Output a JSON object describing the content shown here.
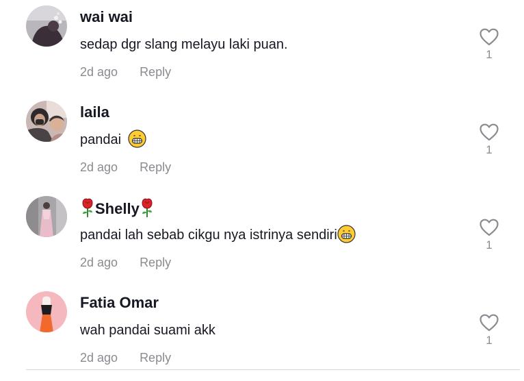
{
  "comments": [
    {
      "username": "wai wai",
      "text": "sedap dgr slang melayu laki puan.",
      "time": "2d ago",
      "reply": "Reply",
      "likes": "1"
    },
    {
      "username": "laila",
      "text": "pandai ",
      "emoji": "grinning-face-emoji",
      "time": "2d ago",
      "reply": "Reply",
      "likes": "1"
    },
    {
      "username": "Shelly",
      "username_decoration": "rose-emoji",
      "text": "pandai lah sebab cikgu nya istrinya sendiri",
      "emoji": "grinning-face-emoji",
      "time": "2d ago",
      "reply": "Reply",
      "likes": "1"
    },
    {
      "username": "Fatia Omar",
      "text": "wah pandai suami akk",
      "time": "2d ago",
      "reply": "Reply",
      "likes": "1"
    }
  ],
  "icons": {
    "like": "heart-outline-icon"
  },
  "colors": {
    "text": "#161823",
    "secondary": "#8a8b91",
    "divider": "#d8d8da"
  }
}
